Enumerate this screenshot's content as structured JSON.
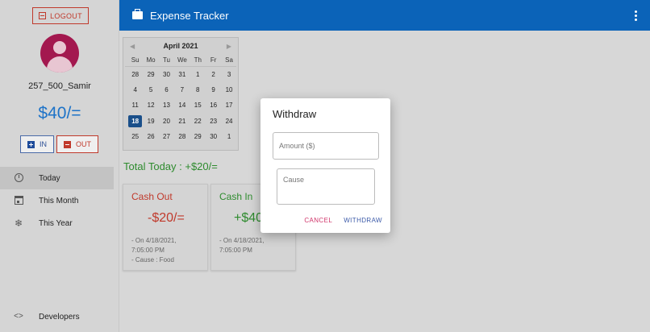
{
  "app": {
    "title": "Expense Tracker"
  },
  "sidebar": {
    "logout_label": "LOGOUT",
    "username": "257_500_Samir",
    "balance": "$40/=",
    "in_label": "IN",
    "out_label": "OUT",
    "nav": [
      {
        "label": "Today",
        "icon": "alarm-clock-icon",
        "active": true
      },
      {
        "label": "This Month",
        "icon": "calendar-icon",
        "active": false
      },
      {
        "label": "This Year",
        "icon": "snowflake-icon",
        "active": false
      }
    ],
    "developers_label": "Developers",
    "developers_icon": "code-icon"
  },
  "calendar": {
    "month_label": "April 2021",
    "weekdays": [
      "Su",
      "Mo",
      "Tu",
      "We",
      "Th",
      "Fr",
      "Sa"
    ],
    "weeks": [
      [
        "28",
        "29",
        "30",
        "31",
        "1",
        "2",
        "3"
      ],
      [
        "4",
        "5",
        "6",
        "7",
        "8",
        "9",
        "10"
      ],
      [
        "11",
        "12",
        "13",
        "14",
        "15",
        "16",
        "17"
      ],
      [
        "18",
        "19",
        "20",
        "21",
        "22",
        "23",
        "24"
      ],
      [
        "25",
        "26",
        "27",
        "28",
        "29",
        "30",
        "1"
      ]
    ],
    "selected_day": "18"
  },
  "summary": {
    "total_today": "Total Today : +$20/="
  },
  "cards": [
    {
      "title": "Cash Out",
      "amount": "-$20/=",
      "line1": "- On 4/18/2021,",
      "line2": "7:05:00 PM",
      "line3": "- Cause : Food",
      "color": "#c0392b"
    },
    {
      "title": "Cash In",
      "amount": "+$40",
      "line1": "- On 4/18/2021,",
      "line2": "7:05:00 PM",
      "line3": "",
      "color": "#2e8b2e"
    }
  ],
  "dialog": {
    "title": "Withdraw",
    "amount_placeholder": "Amount ($)",
    "cause_placeholder": "Cause",
    "cancel_label": "CANCEL",
    "withdraw_label": "WITHDRAW"
  },
  "colors": {
    "appbar": "#0b63b8",
    "balance": "#1e73c8",
    "positive": "#2e8b2e",
    "negative": "#c0392b"
  }
}
